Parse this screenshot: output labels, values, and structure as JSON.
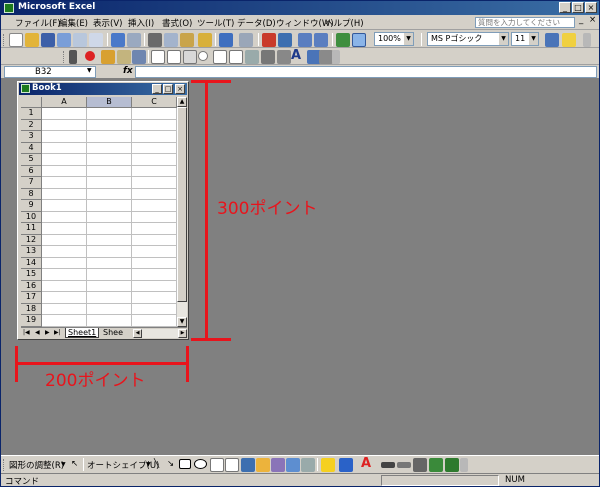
{
  "window": {
    "title": "Microsoft Excel"
  },
  "menu": {
    "items": [
      "ファイル(F)",
      "編集(E)",
      "表示(V)",
      "挿入(I)",
      "書式(O)",
      "ツール(T)",
      "データ(D)",
      "ウィンドウ(W)",
      "ヘルプ(H)"
    ],
    "help_placeholder": "質問を入力してください"
  },
  "standard_toolbar": {
    "zoom": "100%"
  },
  "format_toolbar": {
    "font": "MS Pゴシック",
    "size": "11"
  },
  "formula_bar": {
    "name_box": "B32",
    "fx": "fx",
    "formula": ""
  },
  "workbook": {
    "title": "Book1",
    "columns": [
      "A",
      "B",
      "C"
    ],
    "selected_column": "B",
    "rows": [
      "1",
      "2",
      "3",
      "4",
      "5",
      "6",
      "7",
      "8",
      "9",
      "10",
      "11",
      "12",
      "13",
      "14",
      "15",
      "16",
      "17",
      "18",
      "19"
    ],
    "tabs": [
      "Sheet1",
      "Shee"
    ]
  },
  "annotations": {
    "height_label": "300ポイント",
    "width_label": "200ポイント"
  },
  "drawing_toolbar": {
    "draw": "図形の調整(R)",
    "autoshapes": "オートシェイプ(U)"
  },
  "status": {
    "mode": "コマンド",
    "num": "NUM"
  },
  "colors": {
    "title_bar": "#0a246a",
    "annotation": "#e8141c",
    "workspace": "#808080"
  }
}
